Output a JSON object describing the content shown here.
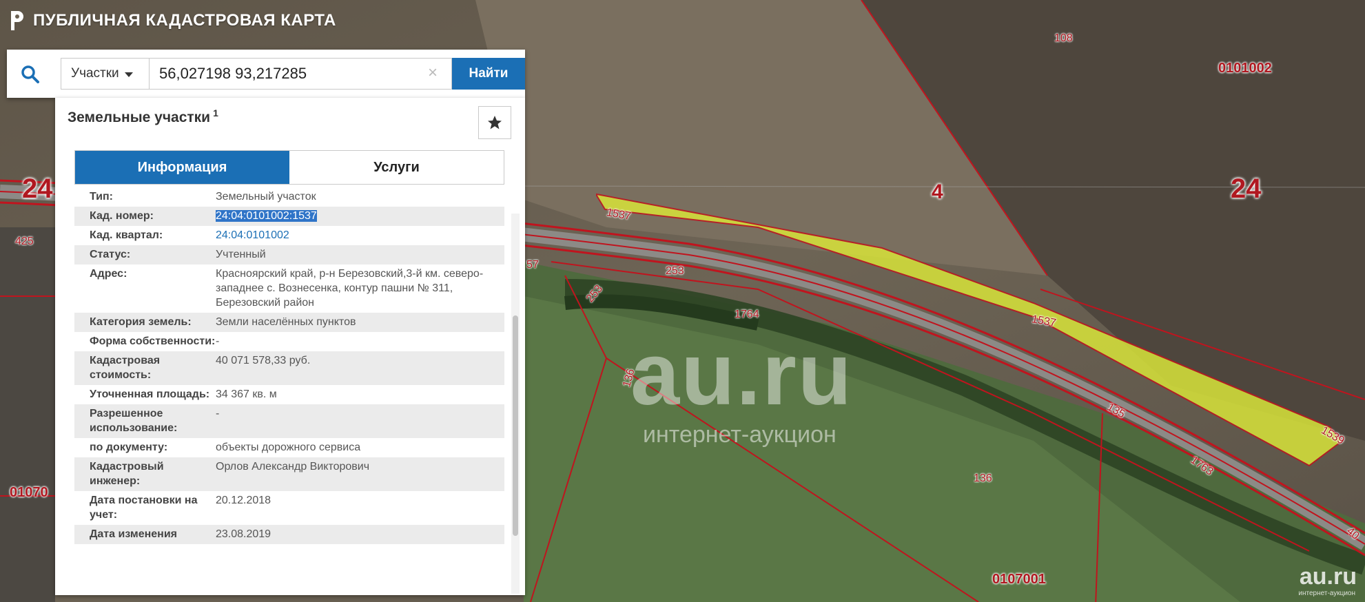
{
  "app": {
    "title": "ПУБЛИЧНАЯ КАДАСТРОВАЯ КАРТА"
  },
  "search": {
    "layer": "Участки",
    "query": "56,027198 93,217285",
    "find_label": "Найти"
  },
  "panel": {
    "title": "Земельные участки",
    "count": "1",
    "tabs": [
      {
        "label": "Информация",
        "active": true
      },
      {
        "label": "Услуги",
        "active": false
      }
    ],
    "rows": [
      {
        "key": "Тип:",
        "value": "Земельный участок"
      },
      {
        "key": "Кад. номер:",
        "value": "24:04:0101002:1537"
      },
      {
        "key": "Кад. квартал:",
        "value": "24:04:0101002"
      },
      {
        "key": "Статус:",
        "value": "Учтенный"
      },
      {
        "key": "Адрес:",
        "value": "Красноярский край, р-н Березовский,3-й км. северо-западнее с. Вознесенка, контур пашни № 311, Березовский район"
      },
      {
        "key": "Категория земель:",
        "value": "Земли населённых пунктов"
      },
      {
        "key": "Форма собственности:",
        "value": "-"
      },
      {
        "key": "Кадастровая стоимость:",
        "value": "40 071 578,33 руб."
      },
      {
        "key": "Уточненная площадь:",
        "value": "34 367 кв. м"
      },
      {
        "key": "Разрешенное использование:",
        "value": "-"
      },
      {
        "key": "по документу:",
        "value": "объекты дорожного сервиса"
      },
      {
        "key": "Кадастровый инженер:",
        "value": "Орлов Александр Викторович"
      },
      {
        "key": "Дата постановки на учет:",
        "value": "20.12.2018"
      },
      {
        "key": "Дата изменения",
        "value": "23.08.2019"
      }
    ]
  },
  "map": {
    "plot_labels": [
      "108",
      "1537",
      "1537",
      "253",
      "253",
      "1764",
      "136",
      "136",
      "135",
      "1763",
      "1539",
      "425",
      "57",
      "40"
    ],
    "quarter_labels": [
      "0101002",
      "0107001",
      "01070"
    ],
    "district_labels": [
      "24",
      "24",
      "4"
    ]
  },
  "watermark": {
    "big": "au.ru",
    "small": "интернет-аукцион",
    "corner": "au.ru",
    "corner_sub": "интернет-аукцион"
  },
  "colors": {
    "accent": "#1b6fb5",
    "boundary": "#c0141e",
    "highlight_plot": "#d8e43a"
  }
}
